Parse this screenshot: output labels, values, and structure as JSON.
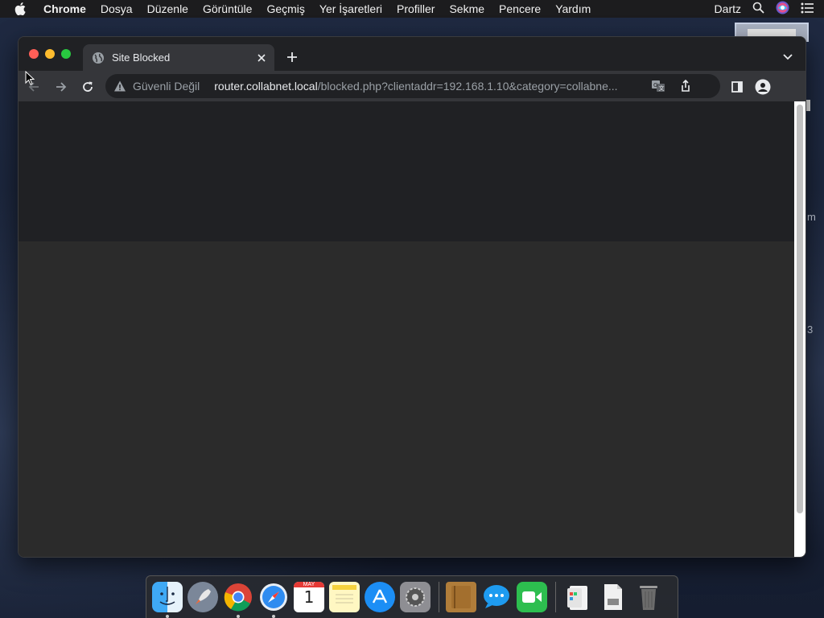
{
  "menubar": {
    "app": "Chrome",
    "items": [
      "Dosya",
      "Düzenle",
      "Görüntüle",
      "Geçmiş",
      "Yer İşaretleri",
      "Profiller",
      "Sekme",
      "Pencere",
      "Yardım"
    ],
    "user": "Dartz"
  },
  "desktop": {
    "side_letter_1": "m",
    "side_letter_2": "3"
  },
  "tab": {
    "title": "Site Blocked",
    "favicon": "globe-icon"
  },
  "omnibox": {
    "security_label": "Güvenli Değil",
    "host": "router.collabnet.local",
    "path": "/blocked.php?clientaddr=192.168.1.10&category=collabne..."
  },
  "dock": {
    "apps": [
      "Finder",
      "Launchpad",
      "Google Chrome",
      "Safari",
      "Calendar",
      "Notes",
      "App Store",
      "System Preferences",
      "Notefile",
      "Messages",
      "FaceTime",
      "Preview",
      "Documents",
      "Trash"
    ],
    "calendar": {
      "month": "MAY",
      "day": "1"
    }
  },
  "colors": {
    "window_bg": "#202124",
    "toolbar": "#35363a",
    "content": "#2b2b2b"
  }
}
